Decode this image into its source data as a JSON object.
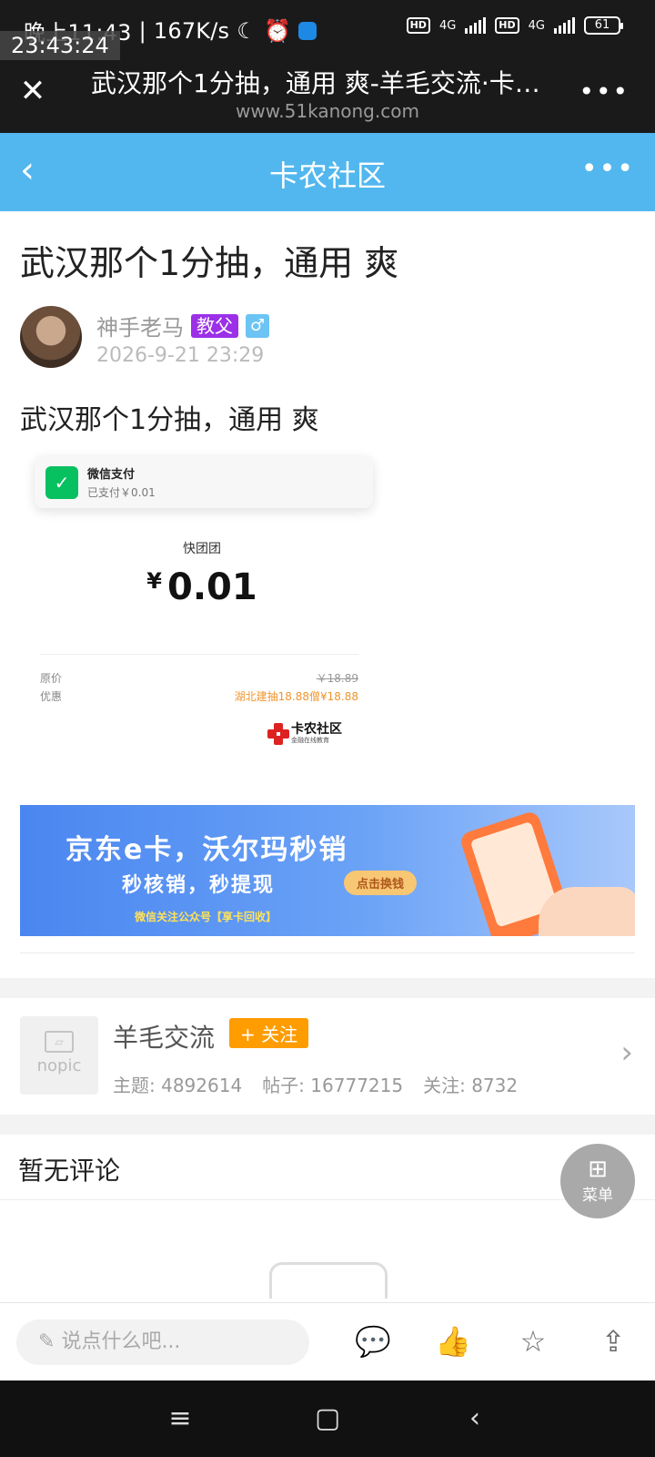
{
  "status_bar": {
    "time": "晚上11:43",
    "speed": "167K/s",
    "overlay_time": "23:43:24",
    "network1": "4G",
    "network2": "4G",
    "battery": "61"
  },
  "browser": {
    "title": "武汉那个1分抽，通用 爽-羊毛交流·卡农社区",
    "url": "www.51kanong.com"
  },
  "app_header": {
    "title": "卡农社区"
  },
  "post": {
    "title": "武汉那个1分抽，通用 爽",
    "author": "神手老马",
    "rank_tag": "教父",
    "gender_icon": "♂",
    "time": "2026-9-21 23:29",
    "body": "武汉那个1分抽，通用  爽"
  },
  "receipt": {
    "notif_title": "微信支付",
    "notif_sub": "已支付￥0.01",
    "merchant": "快团团",
    "currency": "¥",
    "amount": "0.01",
    "rows": [
      {
        "label": "原价",
        "value": "￥18.89"
      },
      {
        "label": "优惠",
        "value": "湖北建抽18.88僧¥18.88"
      }
    ],
    "logo_text": "卡农社区",
    "logo_sub": "金融在线教育"
  },
  "banner": {
    "title": "京东e卡，沃尔玛秒销",
    "subtitle": "秒核销，秒提现",
    "button": "点击换钱",
    "footer": "微信关注公众号【享卡回收】"
  },
  "forum": {
    "nopic_label": "nopic",
    "name": "羊毛交流",
    "follow_label": "+ 关注",
    "stats": [
      {
        "label": "主题:",
        "value": "4892614"
      },
      {
        "label": "帖子:",
        "value": "16777215"
      },
      {
        "label": "关注:",
        "value": "8732"
      }
    ]
  },
  "comments": {
    "title": "暂无评论"
  },
  "fab": {
    "label": "菜单"
  },
  "action_bar": {
    "placeholder": "说点什么吧..."
  },
  "colors": {
    "header_blue": "#52b7ee",
    "rank_purple": "#9b30e8",
    "follow_orange": "#ff9c00",
    "wechat_green": "#07c160"
  }
}
